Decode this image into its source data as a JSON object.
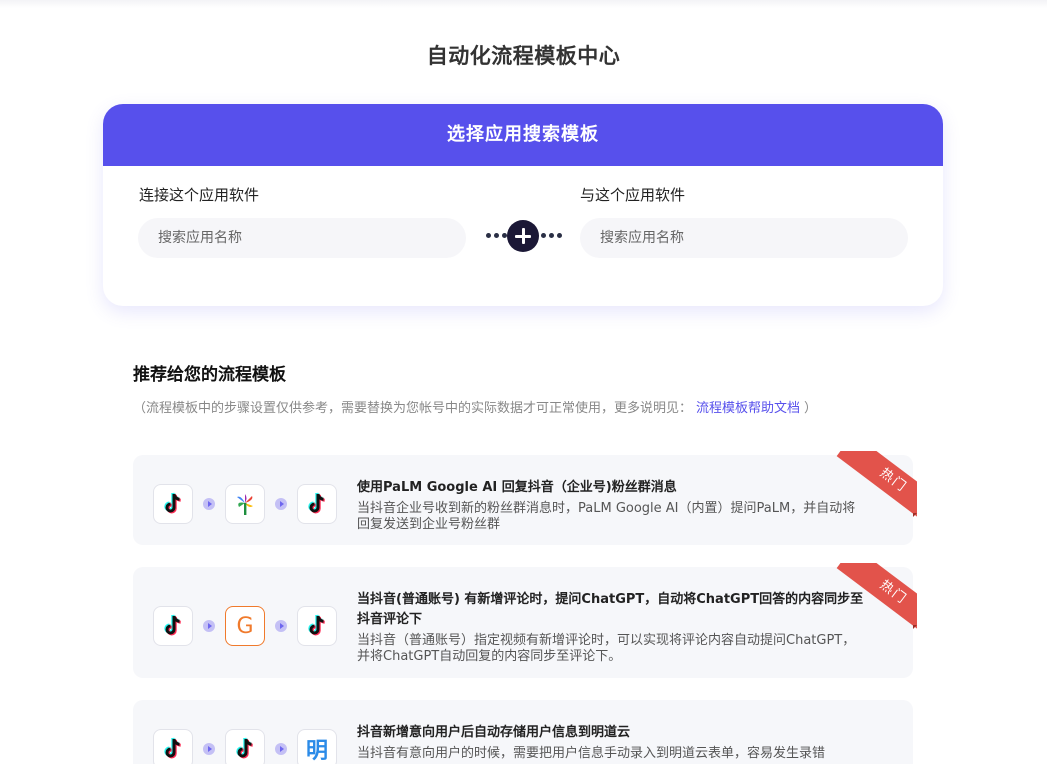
{
  "page": {
    "title": "自动化流程模板中心"
  },
  "search": {
    "header": "选择应用搜索模板",
    "left_label": "连接这个应用软件",
    "left_placeholder": "搜索应用名称",
    "right_label": "与这个应用软件",
    "right_placeholder": "搜索应用名称"
  },
  "recommend": {
    "title": "推荐给您的流程模板",
    "note_prefix": "（流程模板中的步骤设置仅供参考，需要替换为您帐号中的实际数据才可正常使用，更多说明见：",
    "note_link": "流程模板帮助文档",
    "note_suffix": "）"
  },
  "templates": [
    {
      "title": "使用PaLM Google AI 回复抖音（企业号)粉丝群消息",
      "desc": "当抖音企业号收到新的粉丝群消息时，PaLM Google AI（内置）提问PaLM，并自动将回复发送到企业号粉丝群",
      "badge": "热门",
      "apps": [
        "tiktok-icon",
        "palm-icon",
        "tiktok-icon"
      ]
    },
    {
      "title": "当抖音(普通账号) 有新增评论时，提问ChatGPT，自动将ChatGPT回答的内容同步至抖音评论下",
      "desc": "当抖音（普通账号）指定视频有新增评论时，可以实现将评论内容自动提问ChatGPT，并将ChatGPT自动回复的内容同步至评论下。",
      "badge": "热门",
      "apps": [
        "tiktok-icon",
        "g-icon",
        "tiktok-icon"
      ],
      "g_letter": "G"
    },
    {
      "title": "抖音新增意向用户后自动存储用户信息到明道云",
      "desc": "当抖音有意向用户的时候，需要把用户信息手动录入到明道云表单，容易发生录错",
      "apps": [
        "tiktok-icon",
        "tiktok-icon",
        "mingdao-icon"
      ],
      "ming_char": "明"
    }
  ],
  "colors": {
    "accent": "#5750ec",
    "badge": "#e2534b",
    "card_bg": "#f6f7fa",
    "tiktok_cyan": "#25f4ee",
    "tiktok_red": "#fe2c55"
  }
}
